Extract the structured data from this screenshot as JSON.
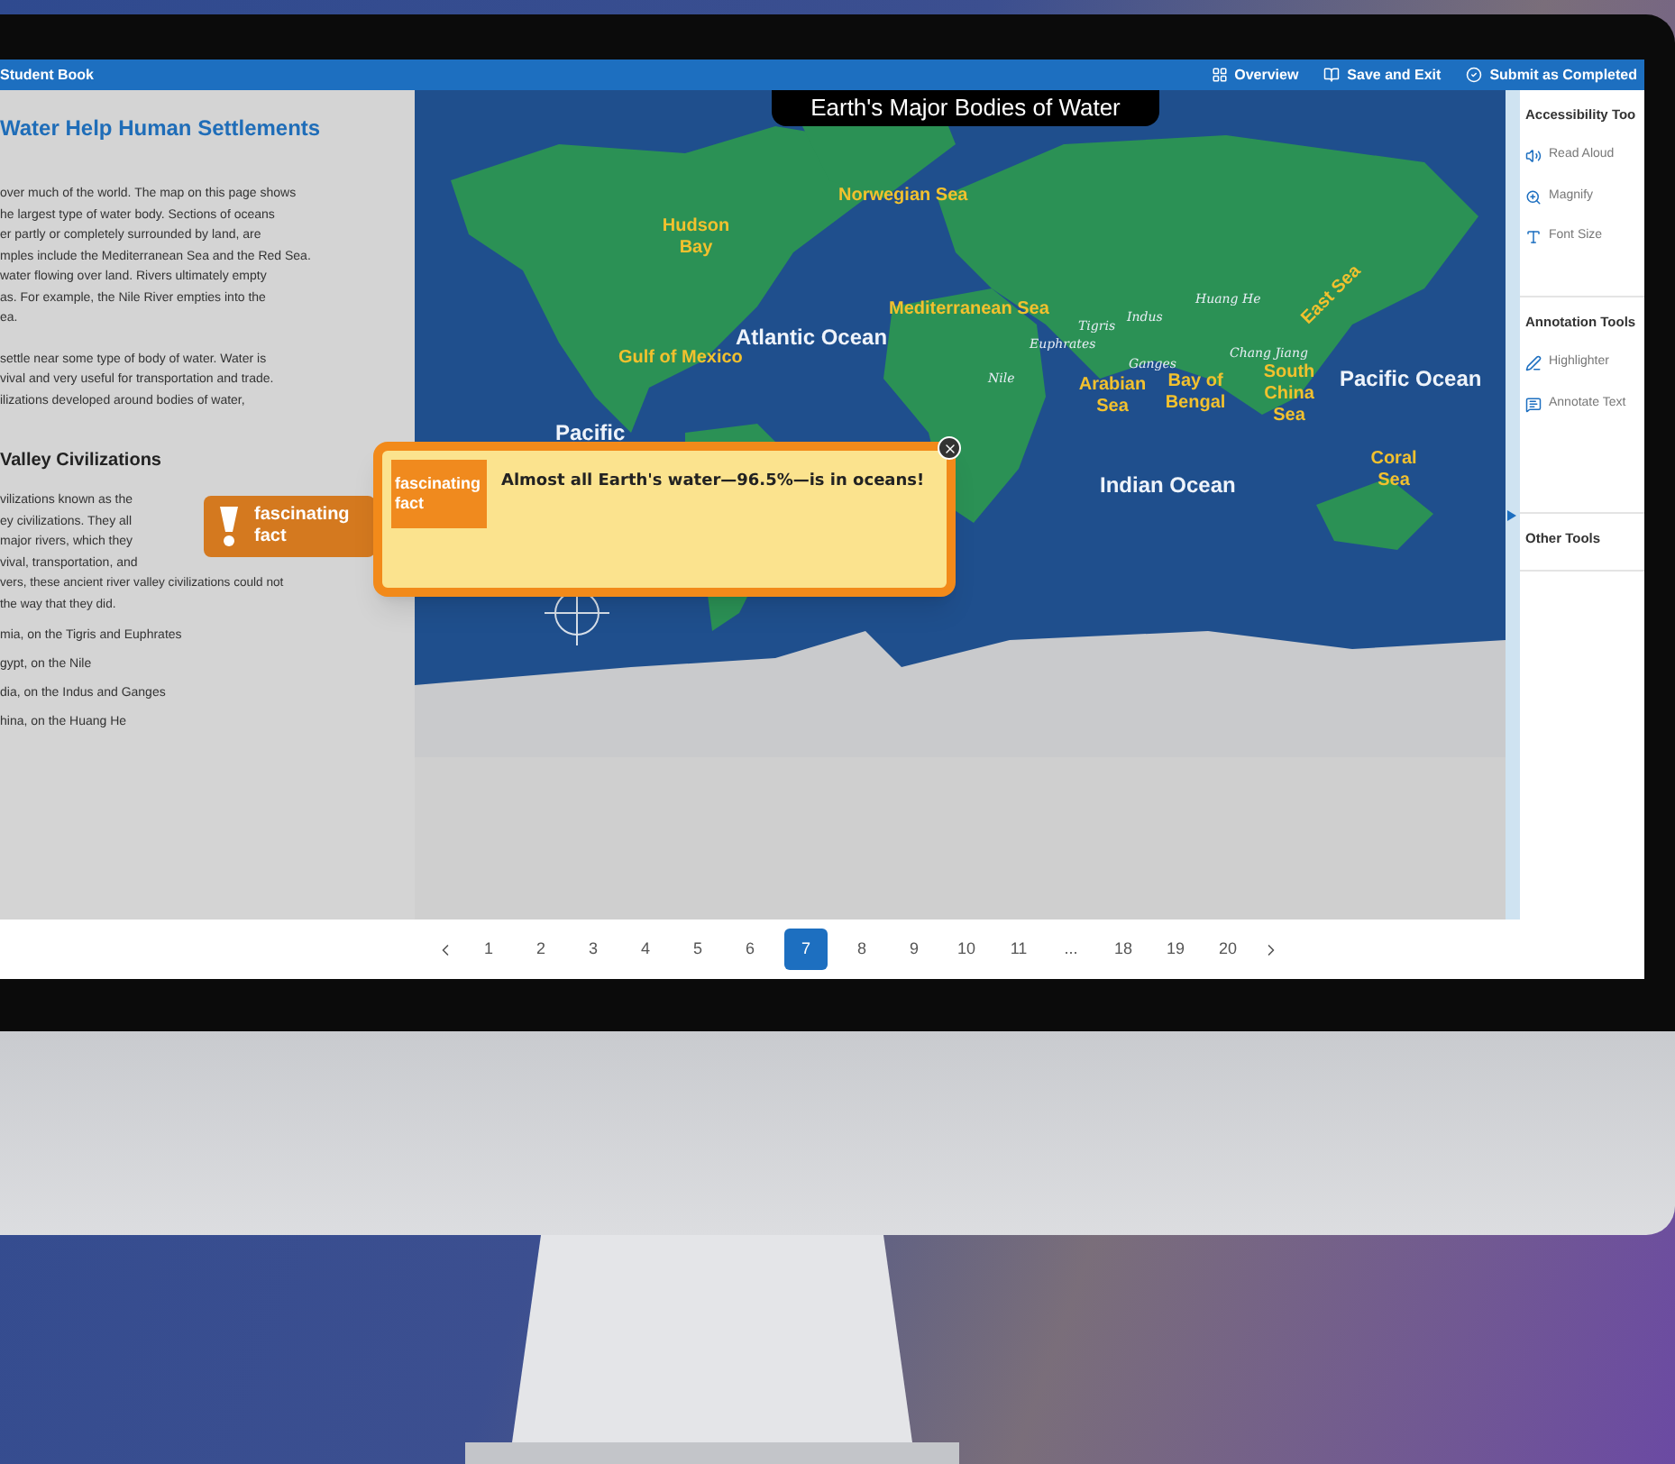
{
  "header": {
    "title": "Student Book",
    "actions": [
      {
        "kind": "overview",
        "label": "Overview"
      },
      {
        "kind": "save",
        "label": "Save and Exit"
      },
      {
        "kind": "submit",
        "label": "Submit as Completed"
      }
    ]
  },
  "lesson": {
    "heading": "Water Help Human Settlements",
    "paragraphs": [
      [
        "over much of the world. The map on this page shows",
        "he largest type of water body. Sections of oceans",
        "er partly or completely surrounded by land, are",
        "mples include the Mediterranean Sea and the Red Sea.",
        "water flowing over land. Rivers ultimately empty",
        "as. For example, the Nile River empties into the",
        "ea."
      ],
      [
        "settle near some type of body of water. Water is",
        "vival and very useful for transportation and trade.",
        "ilizations developed around bodies of water,"
      ]
    ],
    "subheading": "Valley Civilizations",
    "lines_beside_badge": [
      "vilizations known as the",
      "ey civilizations. They all",
      "major rivers, which they",
      "vival, transportation, and"
    ],
    "badge": [
      "fascinating",
      "fact"
    ],
    "lines_after_badge": [
      "vers, these ancient river valley civilizations could not",
      "the way that they did."
    ],
    "list": [
      "mia, on the Tigris and Euphrates",
      "gypt, on the Nile",
      "dia, on the Indus and Ganges",
      "hina, on the Huang He"
    ]
  },
  "map": {
    "title": "Earth's Major Bodies of Water",
    "labels": [
      {
        "kind": "sea",
        "text": "Norwegian Sea"
      },
      {
        "kind": "sea",
        "text": "Hudson Bay"
      },
      {
        "kind": "ocean",
        "text": "Atlantic Ocean"
      },
      {
        "kind": "sea",
        "text": "Gulf of Mexico"
      },
      {
        "kind": "sea",
        "text": "Mediterranean Sea"
      },
      {
        "kind": "river",
        "text": "Tigris"
      },
      {
        "kind": "river",
        "text": "Euphrates"
      },
      {
        "kind": "river",
        "text": "Nile"
      },
      {
        "kind": "river",
        "text": "Indus"
      },
      {
        "kind": "river",
        "text": "Huang He"
      },
      {
        "kind": "river",
        "text": "Ganges"
      },
      {
        "kind": "river",
        "text": "Chang Jiang"
      },
      {
        "kind": "sea",
        "text": "Arabian Sea"
      },
      {
        "kind": "sea",
        "text": "Bay of Bengal"
      },
      {
        "kind": "sea",
        "text": "South China Sea"
      },
      {
        "kind": "sea",
        "text": "East Sea"
      },
      {
        "kind": "ocean",
        "text": "Pacific Ocean"
      },
      {
        "kind": "ocean",
        "text": "Pacific"
      },
      {
        "kind": "ocean",
        "text": "Indian Ocean"
      },
      {
        "kind": "sea",
        "text": "Coral Sea"
      }
    ]
  },
  "popup": {
    "icon_text": [
      "fascinating",
      "fact"
    ],
    "message": "Almost all Earth's water—96.5%—is in oceans!"
  },
  "tools": [
    {
      "title": "Accessibility Too",
      "items": [
        {
          "kind": "read",
          "label": "Read Aloud"
        },
        {
          "kind": "magnify",
          "label": "Magnify"
        },
        {
          "kind": "font",
          "label": "Font Size"
        }
      ]
    },
    {
      "title": "Annotation Tools",
      "items": [
        {
          "kind": "highlight",
          "label": "Highlighter"
        },
        {
          "kind": "annotate",
          "label": "Annotate Text"
        }
      ]
    },
    {
      "title": "Other Tools"
    }
  ],
  "pagination": [
    {
      "label": "1",
      "selected": false
    },
    {
      "label": "2",
      "selected": false
    },
    {
      "label": "3",
      "selected": false
    },
    {
      "label": "4",
      "selected": false
    },
    {
      "label": "5",
      "selected": false
    },
    {
      "label": "6",
      "selected": false
    },
    {
      "label": "7",
      "selected": true
    },
    {
      "label": "8",
      "selected": false
    },
    {
      "label": "9",
      "selected": false
    },
    {
      "label": "10",
      "selected": false
    },
    {
      "label": "11",
      "selected": false
    },
    {
      "label": "...",
      "selected": false
    },
    {
      "label": "18",
      "selected": false
    },
    {
      "label": "19",
      "selected": false
    },
    {
      "label": "20",
      "selected": false
    }
  ]
}
